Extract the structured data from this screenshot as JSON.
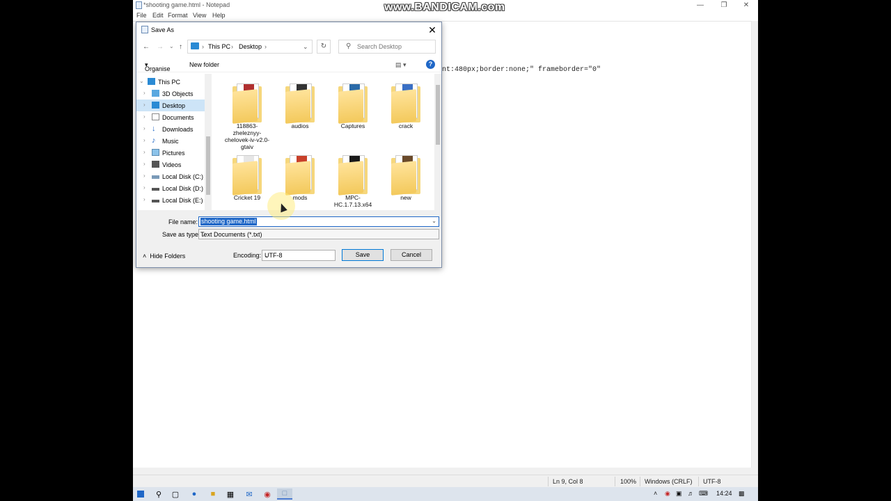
{
  "watermark": "www.BANDICAM.com",
  "notepad": {
    "title": "*shooting game.html - Notepad",
    "menu": [
      "File",
      "Edit",
      "Format",
      "View",
      "Help"
    ],
    "visible_text": "nt:480px;border:none;\" frameborder=\"0\"",
    "status": {
      "position": "Ln 9, Col 8",
      "zoom": "100%",
      "line_endings": "Windows (CRLF)",
      "encoding": "UTF-8"
    }
  },
  "dialog": {
    "title": "Save As",
    "breadcrumb": [
      "This PC",
      "Desktop"
    ],
    "search_placeholder": "Search Desktop",
    "toolbar": {
      "organise": "Organise",
      "new_folder": "New folder"
    },
    "tree": [
      {
        "label": "This PC",
        "icon": "pc-icon"
      },
      {
        "label": "3D Objects",
        "icon": "3d-objects-icon"
      },
      {
        "label": "Desktop",
        "icon": "desktop-icon"
      },
      {
        "label": "Documents",
        "icon": "documents-icon"
      },
      {
        "label": "Downloads",
        "icon": "downloads-icon"
      },
      {
        "label": "Music",
        "icon": "music-icon"
      },
      {
        "label": "Pictures",
        "icon": "pictures-icon"
      },
      {
        "label": "Videos",
        "icon": "videos-icon"
      },
      {
        "label": "Local Disk (C:)",
        "icon": "disk-icon"
      },
      {
        "label": "Local Disk (D:)",
        "icon": "disk-icon"
      },
      {
        "label": "Local Disk (E:)",
        "icon": "disk-icon"
      }
    ],
    "files": [
      {
        "label": "118863-zheleznyy-chelovek-iv-v2.0-gtaiv",
        "color": "#b03030"
      },
      {
        "label": "audios",
        "color": "#333333"
      },
      {
        "label": "Captures",
        "color": "#2a6aa8"
      },
      {
        "label": "crack",
        "color": "#3a6fc4"
      },
      {
        "label": "Cricket 19",
        "color": "#e6e6e6"
      },
      {
        "label": "mods",
        "color": "#c8402a"
      },
      {
        "label": "MPC-HC.1.7.13.x64",
        "color": "#1a1a1a"
      },
      {
        "label": "new",
        "color": "#6a4a2a"
      }
    ],
    "file_name_label": "File name:",
    "file_name": "shooting game.html",
    "save_type_label": "Save as type:",
    "save_type": "Text Documents (*.txt)",
    "encoding_label": "Encoding:",
    "encoding": "UTF-8",
    "save": "Save",
    "cancel": "Cancel",
    "hide_folders": "Hide Folders"
  },
  "taskbar": {
    "clock": "14:24"
  }
}
